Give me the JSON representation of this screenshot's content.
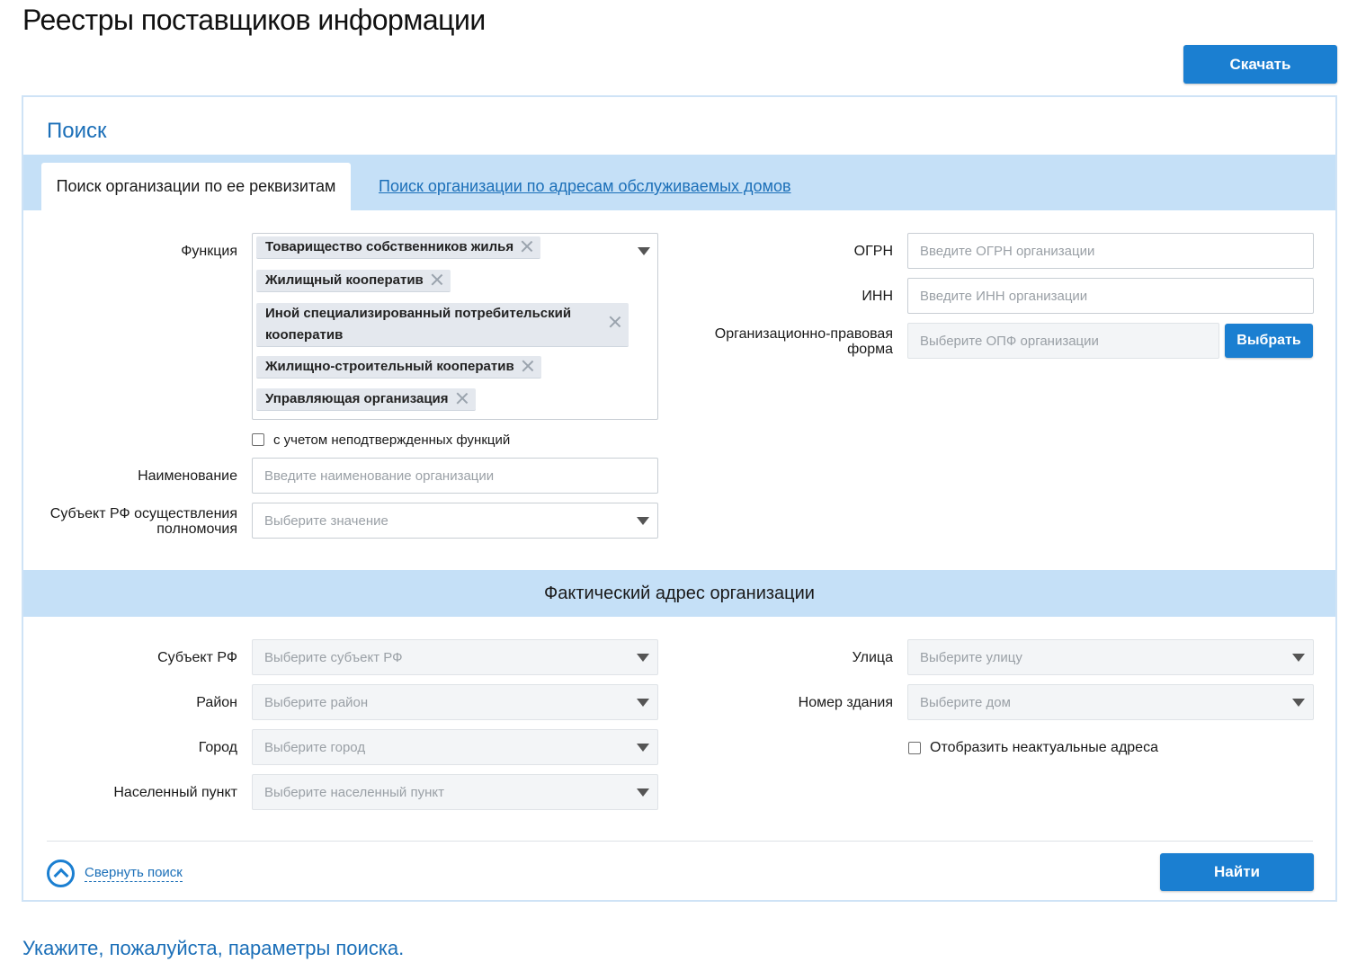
{
  "page": {
    "title": "Реестры поставщиков информации",
    "download_label": "Скачать",
    "hint": "Укажите, пожалуйста, параметры поиска."
  },
  "search": {
    "title": "Поиск",
    "tab_active": "Поиск организации по ее реквизитам",
    "tab_link": "Поиск организации по адресам обслуживаемых домов",
    "function_label": "Функция",
    "function_chips": [
      "Товарищество собственников жилья",
      "Жилищный кооператив",
      "Иной специализированный потребительский",
      "кооператив",
      "Жилищно-строительный кооператив",
      "Управляющая организация"
    ],
    "unconfirmed_label": "с учетом неподтвержденных функций",
    "name_label": "Наименование",
    "name_placeholder": "Введите наименование организации",
    "subject_label_1": "Субъект РФ осуществления",
    "subject_label_2": "полномочия",
    "subject_placeholder": "Выберите значение",
    "ogrn_label": "ОГРН",
    "ogrn_placeholder": "Введите ОГРН организации",
    "inn_label": "ИНН",
    "inn_placeholder": "Введите ИНН организации",
    "opf_label_1": "Организационно-правовая",
    "opf_label_2": "форма",
    "opf_placeholder": "Выберите ОПФ организации",
    "choose_label": "Выбрать"
  },
  "address": {
    "title": "Фактический адрес организации",
    "region_label": "Субъект РФ",
    "region_placeholder": "Выберите субъект РФ",
    "district_label": "Район",
    "district_placeholder": "Выберите район",
    "city_label": "Город",
    "city_placeholder": "Выберите город",
    "settlement_label": "Населенный пункт",
    "settlement_placeholder": "Выберите населенный пункт",
    "street_label": "Улица",
    "street_placeholder": "Выберите улицу",
    "building_label": "Номер здания",
    "building_placeholder": "Выберите дом",
    "outdated_label": "Отобразить неактуальные адреса"
  },
  "footer": {
    "collapse_label": "Свернуть поиск",
    "find_label": "Найти"
  }
}
